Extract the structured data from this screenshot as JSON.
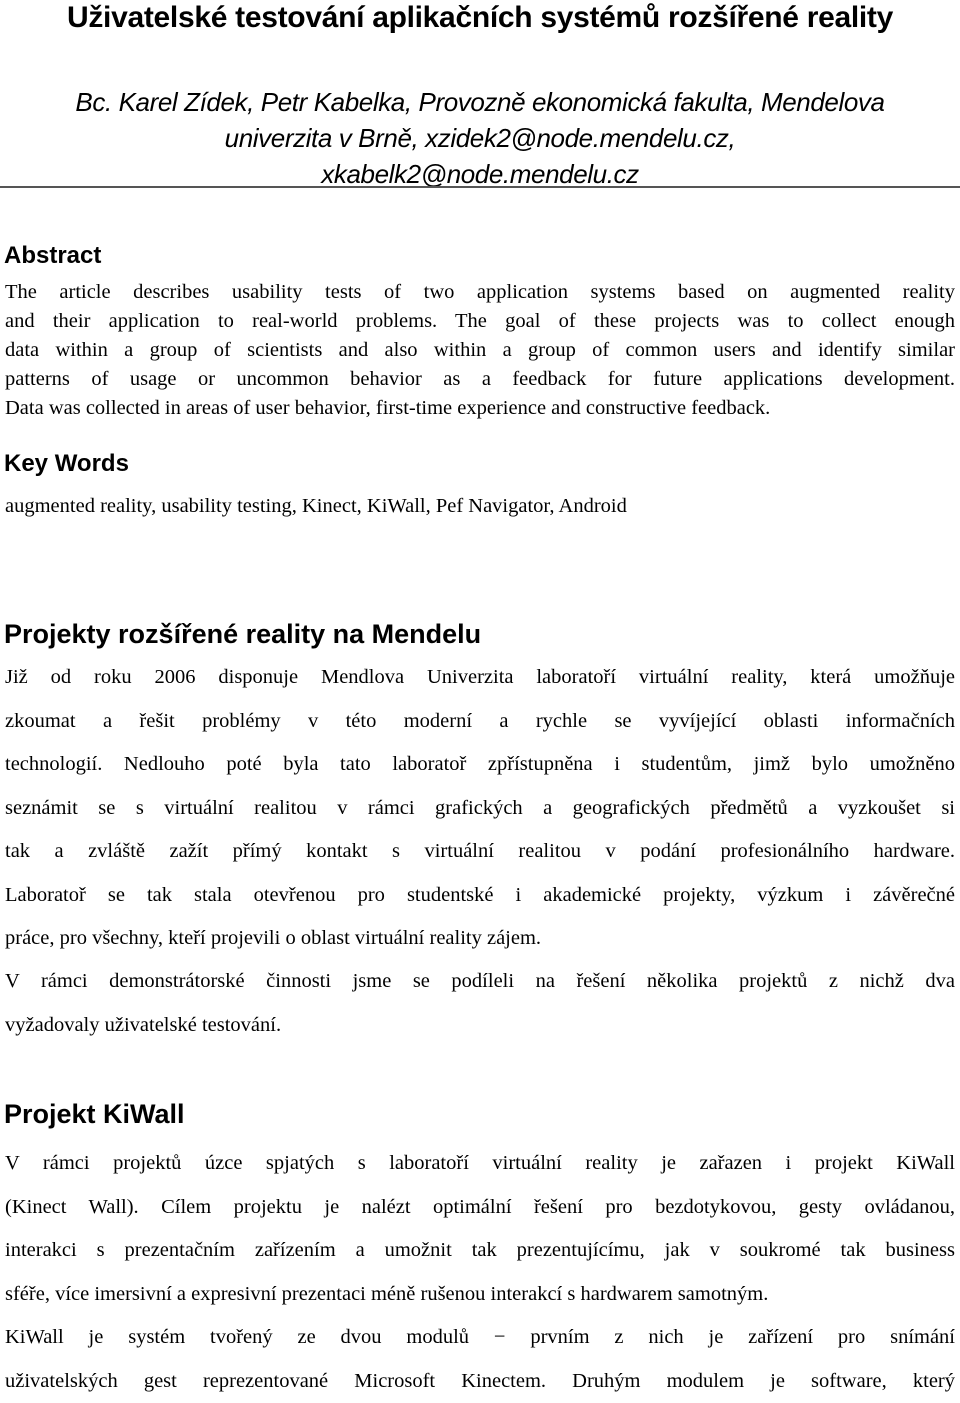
{
  "title": "Uživatelské testování aplikačních systémů rozšířené reality",
  "authors": [
    "Bc. Karel Zídek, Petr Kabelka, Provozně ekonomická fakulta, Mendelova",
    "univerzita v Brně, xzidek2@node.mendelu.cz,",
    "xkabelk2@node.mendelu.cz"
  ],
  "abstract": {
    "heading": "Abstract",
    "lines": [
      "The article describes usability tests of two application systems based on augmented reality",
      "and their application to real-world problems. The goal of these projects was to collect enough",
      "data within a group of scientists and also within a group of common users and identify similar",
      "patterns of usage or uncommon behavior as a feedback for future applications development.",
      "Data was collected in areas of user behavior, first-time experience and constructive feedback."
    ]
  },
  "keywords": {
    "heading": "Key Words",
    "text": "augmented reality, usability testing, Kinect, KiWall, Pef Navigator, Android"
  },
  "section1": {
    "heading": "Projekty rozšířené reality na Mendelu",
    "paragraph1": [
      "Již od roku 2006 disponuje Mendlova Univerzita laboratoří virtuální reality, která umožňuje",
      "zkoumat a řešit problémy v této moderní a rychle se vyvíjející oblasti informačních",
      "technologií. Nedlouho poté byla tato laboratoř zpřístupněna i studentům, jimž bylo umožněno",
      "seznámit se s virtuální realitou v rámci grafických a geografických předmětů a vyzkoušet si",
      "tak a zvláště zažít přímý kontakt s virtuální realitou v podání profesionálního hardware.",
      "Laboratoř se tak stala otevřenou pro studentské i akademické projekty, výzkum i závěrečné",
      "práce, pro všechny, kteří projevili o oblast virtuální reality zájem."
    ],
    "paragraph2": [
      "V rámci demonstrátorské činnosti jsme se podíleli na řešení několika projektů z nichž dva",
      "vyžadovaly uživatelské testování."
    ]
  },
  "section2": {
    "heading": "Projekt KiWall",
    "paragraph1": [
      "V rámci projektů úzce spjatých s laboratoří virtuální reality je zařazen i projekt KiWall",
      "(Kinect Wall). Cílem projektu je nalézt optimální řešení pro bezdotykovou, gesty ovládanou,",
      "interakci s prezentačním zařízením a umožnit tak prezentujícímu, jak v soukromé tak business",
      "sféře, více imersivní a expresivní prezentaci méně rušenou interakcí s hardwarem samotným."
    ],
    "paragraph2": [
      "KiWall je systém tvořený ze dvou modulů − prvním z nich je zařízení pro snímání",
      "uživatelských gest reprezentované Microsoft Kinectem. Druhým modulem je software, který"
    ]
  }
}
